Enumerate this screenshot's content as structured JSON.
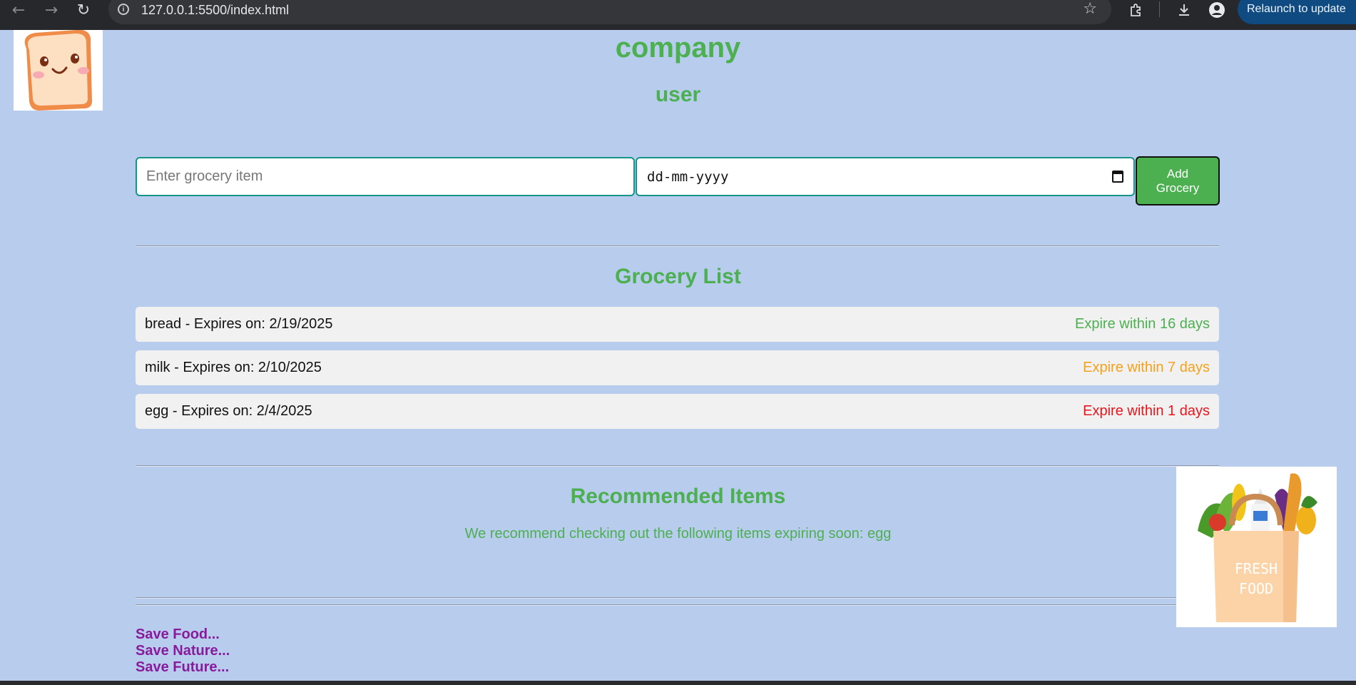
{
  "browser": {
    "url": "127.0.0.1:5500/index.html",
    "relaunch_label": "Relaunch to update",
    "icons": [
      "back-arrow-icon",
      "forward-arrow-icon",
      "reload-icon",
      "info-icon",
      "star-icon",
      "extensions-icon",
      "download-icon",
      "profile-icon",
      "menu-kebab-icon"
    ]
  },
  "header": {
    "company": "company",
    "user": "user"
  },
  "form": {
    "item_placeholder": "Enter grocery item",
    "date_placeholder": "dd-mm-yyyy",
    "add_button_line1": "Add",
    "add_button_line2": "Grocery"
  },
  "grocery_list": {
    "title": "Grocery List",
    "items": [
      {
        "text": "bread - Expires on: 2/19/2025",
        "status": "Expire within 16 days",
        "status_color": "#4caf50"
      },
      {
        "text": "milk - Expires on: 2/10/2025",
        "status": "Expire within 7 days",
        "status_color": "#f5a11a"
      },
      {
        "text": "egg - Expires on: 2/4/2025",
        "status": "Expire within 1 days",
        "status_color": "#e8161c"
      }
    ]
  },
  "recommended": {
    "title": "Recommended Items",
    "text": "We recommend checking out the following items expiring soon: egg"
  },
  "footer": {
    "slogans": [
      "Save Food...",
      "Save Nature...",
      "Save Future..."
    ]
  },
  "images": {
    "logo": "toast-mascot-logo",
    "bag": "fresh-food-bag-illustration",
    "bag_text_line1": "FRESH",
    "bag_text_line2": "FOOD"
  },
  "colors": {
    "background": "#b8cdee",
    "accent": "#4caf50",
    "input_border": "#159488",
    "slogan": "#8a1a9c"
  }
}
